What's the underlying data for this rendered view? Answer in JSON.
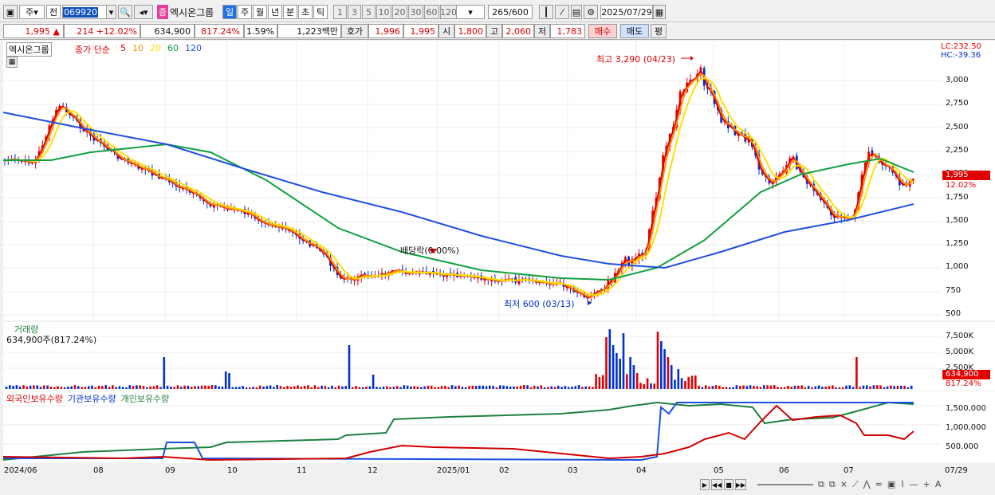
{
  "toolbar": {
    "period_select": "주",
    "prev_label": "전",
    "code": "069920",
    "name_badge": "증",
    "stock_name": "엑시온그룹",
    "periods": [
      "일",
      "주",
      "월",
      "년",
      "분",
      "초",
      "틱"
    ],
    "nums": [
      "1",
      "3",
      "5",
      "10",
      "20",
      "30",
      "60",
      "120"
    ],
    "count": "265",
    "total": "/600",
    "date": "2025/07/29"
  },
  "quote": {
    "price": "1,995",
    "change": "214",
    "change_pct": "+12.02%",
    "volume": "634,900",
    "vol_pct": "817.24%",
    "turnover": "1.59%",
    "amount": "1,223백만",
    "hoga_label": "호가",
    "ask": "1,996",
    "bid": "1,995",
    "open_label": "시",
    "open": "1,800",
    "high_label": "고",
    "high": "2,060",
    "low_label": "저",
    "low": "1,783",
    "buy": "매수",
    "sell": "매도",
    "eval": "평"
  },
  "price_panel": {
    "legend_name": "엑시온그룹",
    "legend_title": "종가 단순",
    "ma": [
      "5",
      "10",
      "20",
      "60",
      "120"
    ],
    "lc": "LC:232.50",
    "hc": "HC:-39.36",
    "high_label": "최고 3,290 (04/23)",
    "low_label": "최저 600 (03/13)",
    "dividend_label": "배당락(0.00%)",
    "last_price": "1,995",
    "last_pct": "12.02%",
    "y_ticks": [
      "3,000",
      "2,750",
      "2,500",
      "2,250",
      "2,000",
      "1,750",
      "1,500",
      "1,250",
      "1,000",
      "750",
      "500"
    ]
  },
  "volume_panel": {
    "title": "거래량",
    "value": "634,900주(817.24%)",
    "y_ticks": [
      "7,500K",
      "5,000K",
      "2,500K"
    ],
    "last": "634,900",
    "last_pct": "817.24%"
  },
  "holders_panel": {
    "foreign": "외국인보유수량",
    "inst": "기관보유수량",
    "indiv": "개인보유수량",
    "y_ticks": [
      "1,500,000",
      "1,000,000",
      "500,000"
    ]
  },
  "x_axis": {
    "ticks": [
      "2024/06",
      "08",
      "09",
      "10",
      "11",
      "12",
      "2025/01",
      "02",
      "03",
      "04",
      "05",
      "06",
      "07",
      "07/29"
    ]
  },
  "colors": {
    "up": "#e00000",
    "down": "#0030d0",
    "ma5": "#e00000",
    "ma10": "#ff9000",
    "ma20": "#ffe000",
    "ma60": "#10a040",
    "ma120": "#2050e0"
  }
}
